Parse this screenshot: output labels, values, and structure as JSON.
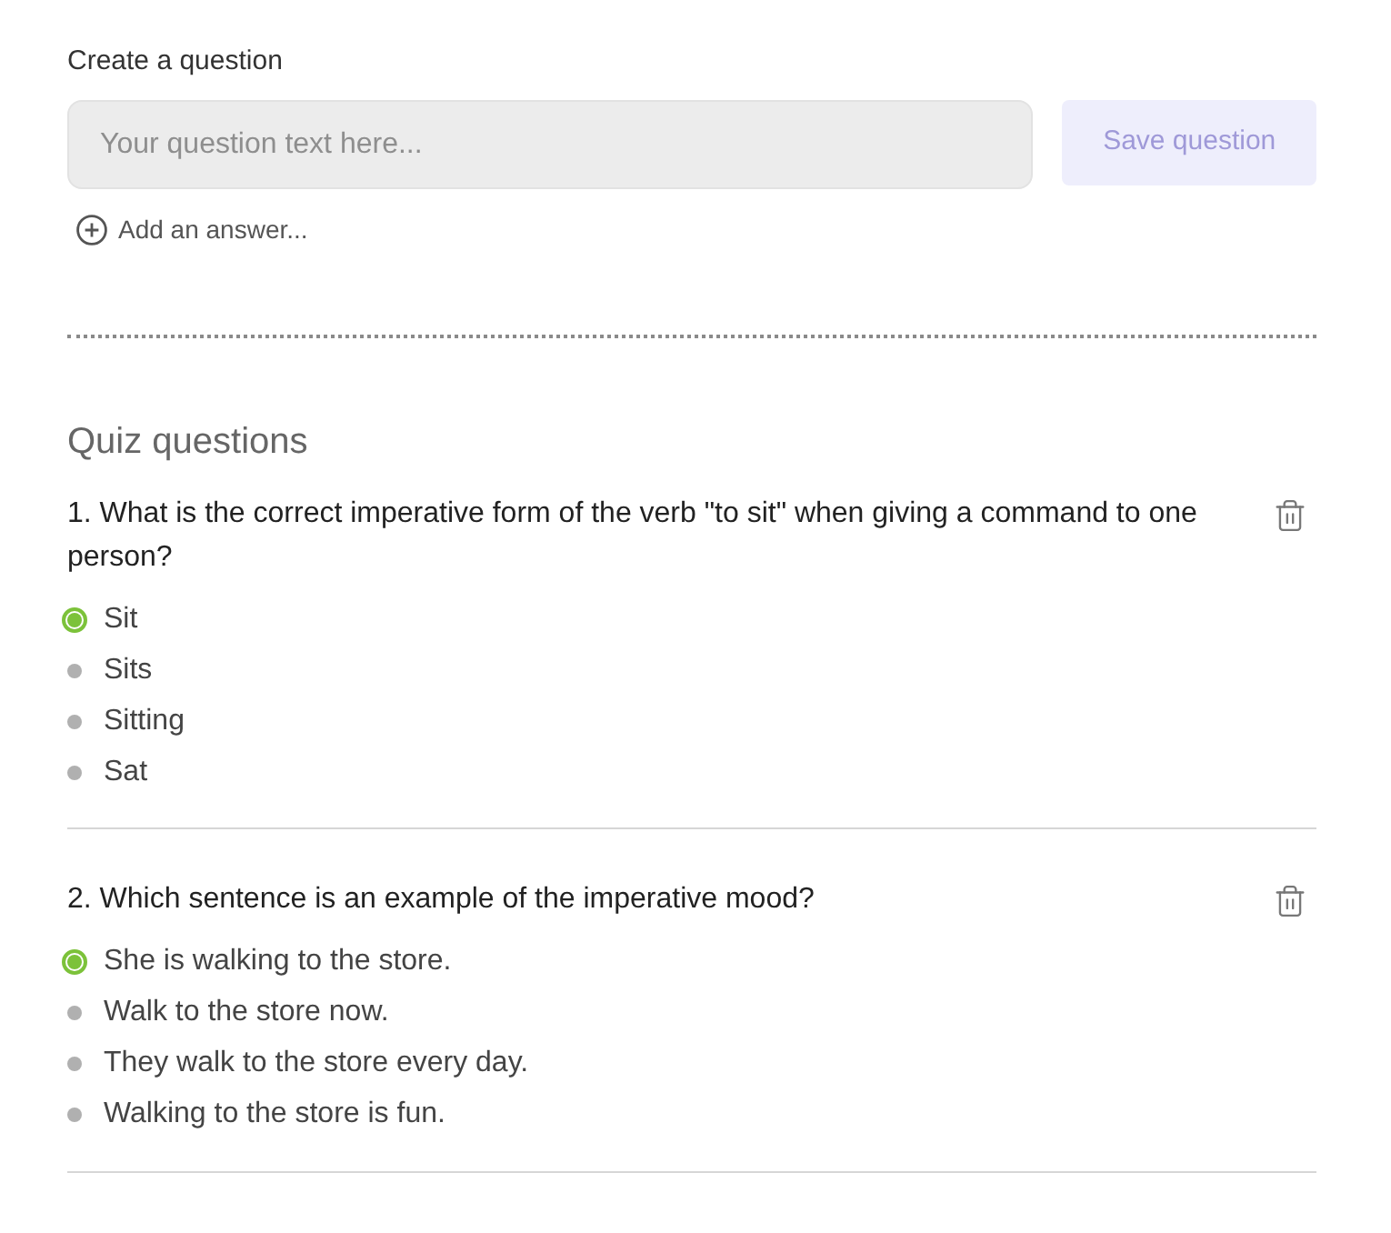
{
  "create": {
    "label": "Create a question",
    "question_field": {
      "placeholder": "Your question text here..."
    },
    "save_button": {
      "label": "Save question",
      "disabled": true
    },
    "add_answer": "Add an answer..."
  },
  "quiz": {
    "title": "Quiz questions",
    "questions": [
      {
        "text": "1. What is the correct imperative form of the verb \"to sit\" when giving a command to one person?",
        "answers": [
          {
            "text": "Sit",
            "correct": true
          },
          {
            "text": "Sits",
            "correct": false
          },
          {
            "text": "Sitting",
            "correct": false
          },
          {
            "text": "Sat",
            "correct": false
          }
        ]
      },
      {
        "text": "2. Which sentence is an example of the imperative mood?",
        "answers": [
          {
            "text": "She is walking to the store.",
            "correct": true
          },
          {
            "text": "Walk to the store now.",
            "correct": false
          },
          {
            "text": "They walk to the store every day.",
            "correct": false
          },
          {
            "text": "Walking to the store is fun.",
            "correct": false
          }
        ]
      }
    ]
  }
}
